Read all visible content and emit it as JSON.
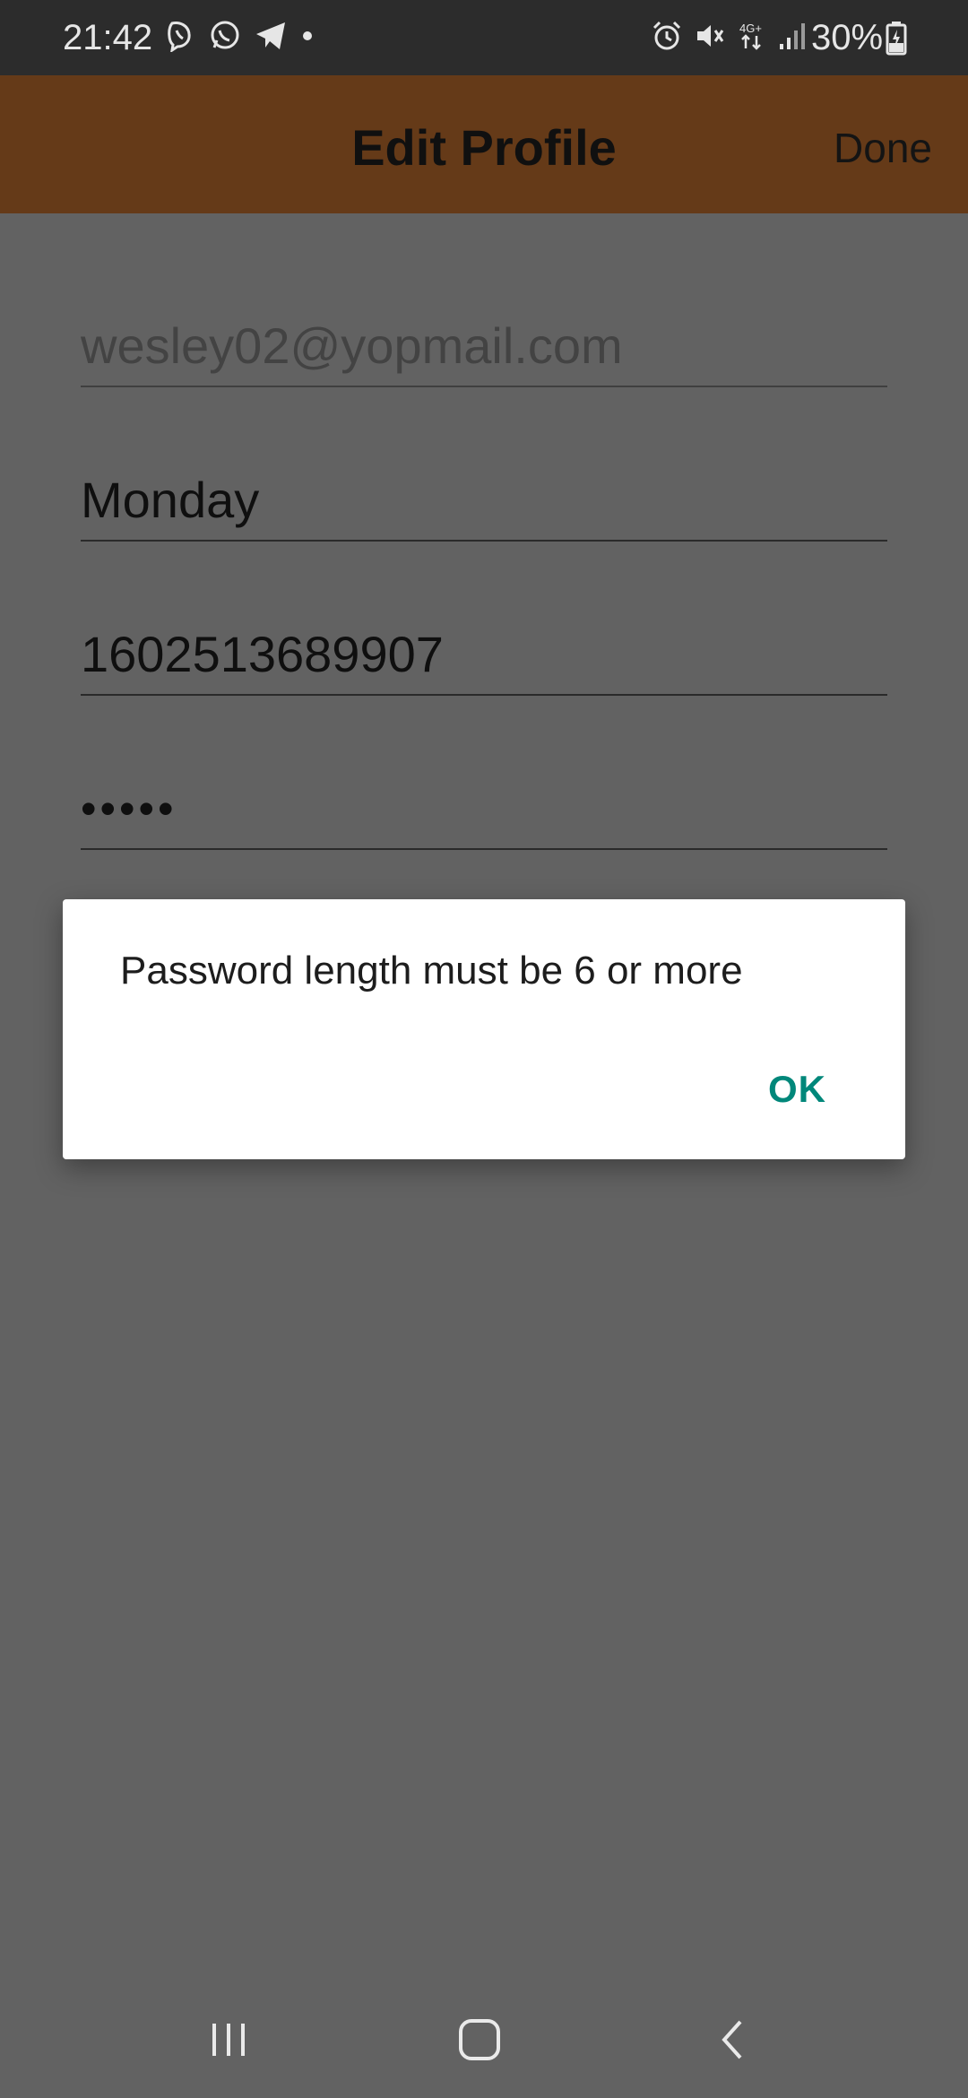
{
  "status_bar": {
    "time": "21:42",
    "battery_percent": "30%",
    "left_icons": [
      "viber-icon",
      "whatsapp-icon",
      "telegram-icon",
      "dot-icon"
    ],
    "right_icons": [
      "alarm-icon",
      "mute-icon",
      "4g-icon",
      "signal-icon",
      "battery-icon"
    ]
  },
  "app_bar": {
    "title": "Edit Profile",
    "done_label": "Done",
    "color": "#653a18"
  },
  "form": {
    "email": "wesley02@yopmail.com",
    "name": "Monday",
    "phone": "1602513689907",
    "password_masked": "•••••"
  },
  "dialog": {
    "message": "Password length must be 6 or more",
    "ok_label": "OK",
    "accent_color": "#00877a"
  },
  "nav_bar": {
    "buttons": [
      "recents-icon",
      "home-icon",
      "back-icon"
    ]
  }
}
